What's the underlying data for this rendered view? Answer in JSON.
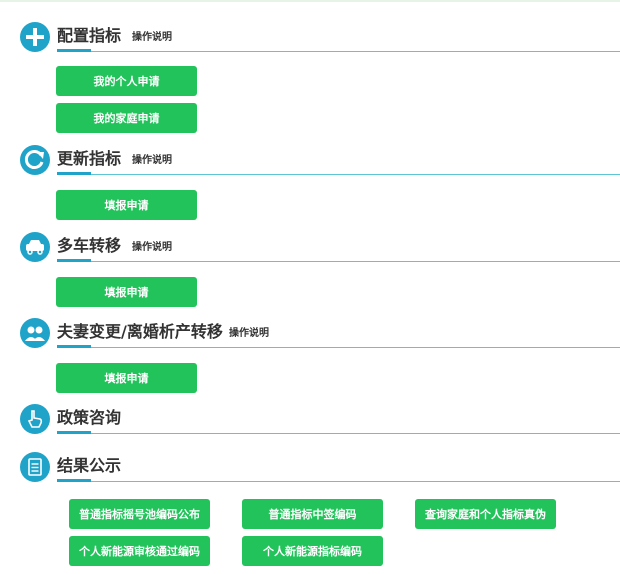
{
  "sections": [
    {
      "title": "配置指标",
      "note": "操作说明",
      "icon": "plus-icon",
      "buttons": [
        "我的个人申请",
        "我的家庭申请"
      ]
    },
    {
      "title": "更新指标",
      "note": "操作说明",
      "icon": "refresh-icon",
      "buttons": [
        "填报申请"
      ]
    },
    {
      "title": "多车转移",
      "note": "操作说明",
      "icon": "car-transfer-icon",
      "buttons": [
        "填报申请"
      ]
    },
    {
      "title": "夫妻变更/离婚析产转移",
      "note": "操作说明",
      "icon": "couple-icon",
      "buttons": [
        "填报申请"
      ]
    },
    {
      "title": "政策咨询",
      "icon": "hand-pointer-icon"
    },
    {
      "title": "结果公示",
      "icon": "document-icon",
      "buttons": [
        "普通指标摇号池编码公布",
        "普通指标中签编码",
        "查询家庭和个人指标真伪",
        "个人新能源审核通过编码",
        "个人新能源指标编码"
      ]
    }
  ],
  "colors": {
    "accent": "#1fa3c9",
    "button": "#21c35a",
    "line": "#5ec5d6"
  }
}
